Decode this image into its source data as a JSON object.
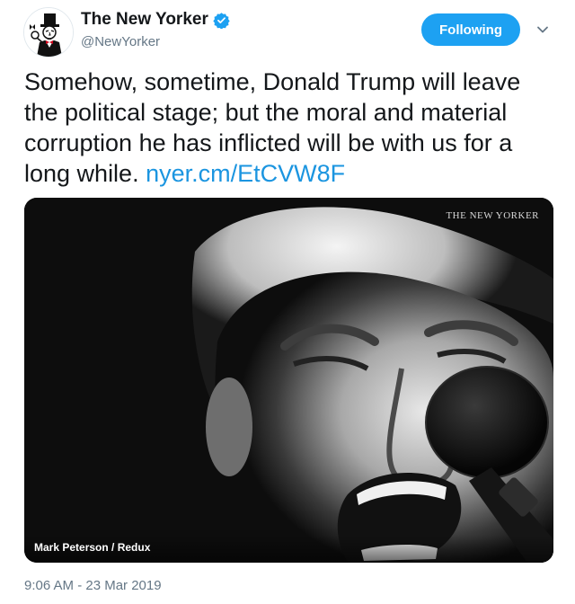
{
  "header": {
    "display_name": "The New Yorker",
    "handle": "@NewYorker",
    "follow_button_label": "Following",
    "verified": true
  },
  "tweet": {
    "text": "Somehow, sometime, Donald Trump will leave the political stage; but the moral and material corruption he has inflicted will be with us for a long while.",
    "link_text": "nyer.cm/EtCVW8F",
    "timestamp": "9:06 AM - 23 Mar 2019"
  },
  "media": {
    "watermark": "THE NEW YORKER",
    "photo_credit": "Mark Peterson / Redux"
  },
  "colors": {
    "accent": "#1da1f2",
    "link": "#1b95e0",
    "secondary_text": "#657786",
    "primary_text": "#14171a"
  },
  "icons": {
    "avatar": "eustace-tilley-icon",
    "verified": "verified-badge-icon",
    "more": "chevron-down-icon"
  }
}
